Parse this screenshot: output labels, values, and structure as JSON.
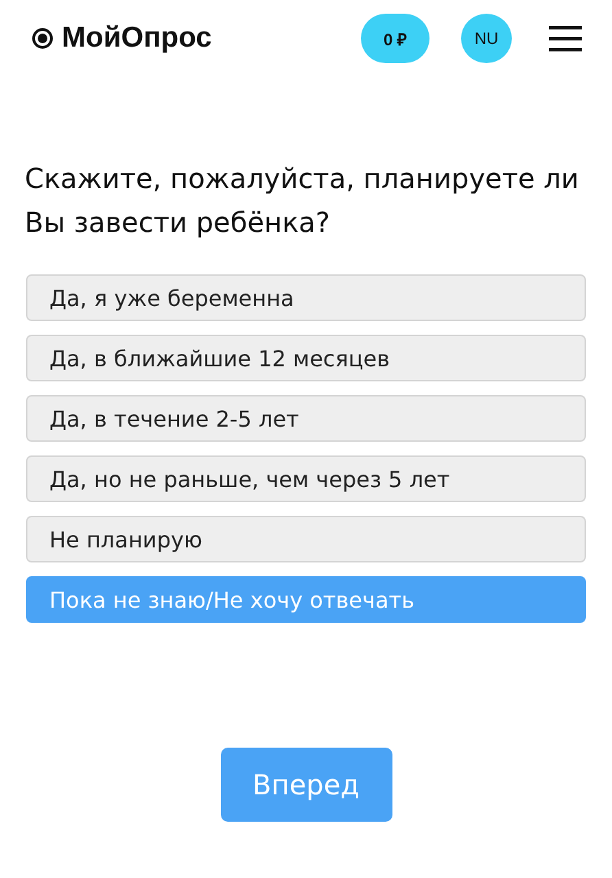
{
  "header": {
    "logo": "МойОпрос",
    "balance": "0 ₽",
    "avatar": "NU"
  },
  "question": "Скажите, пожалуйста, планируете ли Вы завести ребёнка?",
  "options": [
    {
      "label": "Да, я уже беременна",
      "selected": false
    },
    {
      "label": "Да, в ближайшие 12 месяцев",
      "selected": false
    },
    {
      "label": "Да, в течение 2-5 лет",
      "selected": false
    },
    {
      "label": "Да, но не раньше, чем через 5 лет",
      "selected": false
    },
    {
      "label": "Не планирую",
      "selected": false
    },
    {
      "label": "Пока не знаю/Не хочу отвечать",
      "selected": true
    }
  ],
  "next_button": "Вперед"
}
